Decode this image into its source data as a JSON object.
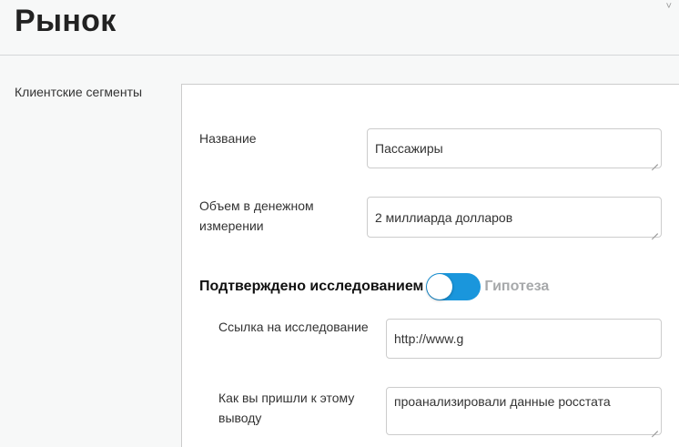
{
  "header": {
    "title": "Рынок",
    "corner_mark": "˅"
  },
  "section": {
    "label": "Клиентские сегменты"
  },
  "form": {
    "name": {
      "label": "Название",
      "value": "Пассажиры"
    },
    "volume": {
      "label_line1": "Объем в денежном",
      "label_line2": "измерении",
      "value": "2 миллиарда долларов"
    },
    "toggle": {
      "left_label": "Подтверждено исследованием",
      "right_label": "Гипотеза",
      "accent_color": "#1a96dc"
    },
    "research_link": {
      "label": "Ссылка на исследование",
      "value": "http://www.g"
    },
    "conclusion": {
      "label_line1": "Как вы пришли к этому",
      "label_line2": "выводу",
      "value": "проанализировали данные росстата"
    }
  }
}
